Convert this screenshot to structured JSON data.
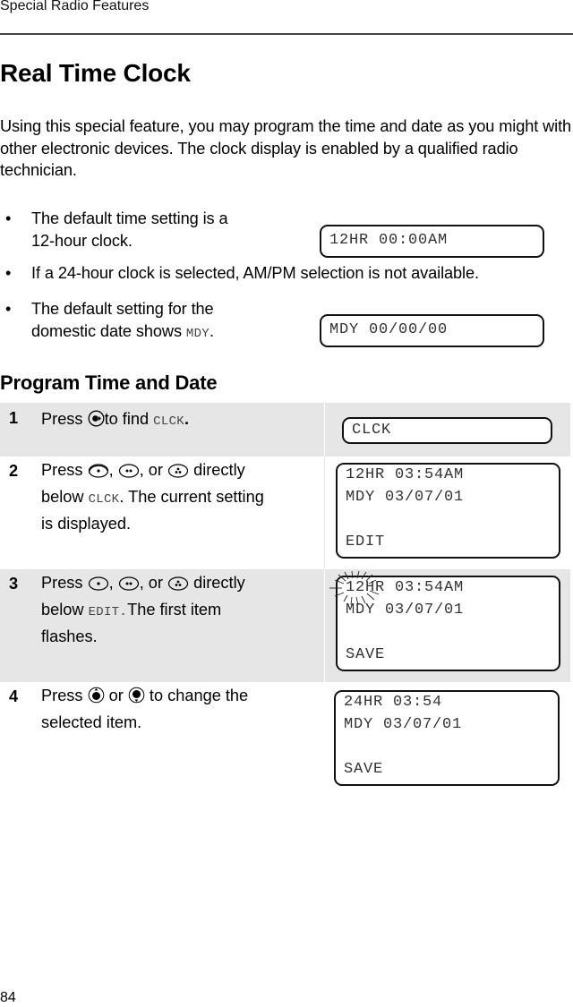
{
  "header": {
    "running_head": "Special Radio Features"
  },
  "page_title": "Real Time Clock",
  "intro": "Using this special feature, you may program the time and date as you might with other electronic devices. The clock display is enabled by a qualified radio technician.",
  "bullets": [
    {
      "text_line1": "The default time setting is a",
      "text_line2": "12-hour clock.",
      "display": "12HR 00:00AM"
    },
    {
      "text_line1": "If a 24-hour clock is selected, AM/PM selection is not available."
    },
    {
      "text_line1": "The default setting for the",
      "text_line2_prefix": "domestic date shows ",
      "text_line2_lcd": "MDY",
      "text_line2_suffix": ".",
      "display": "MDY 00/00/00"
    }
  ],
  "section_title": "Program Time and Date",
  "steps": [
    {
      "number": "1",
      "text": {
        "press": "Press",
        "after_icon": "to find",
        "lcd_word": "CLCK",
        "end": "."
      },
      "icons": [
        "menu-navigation-button"
      ],
      "display": [
        "CLCK"
      ]
    },
    {
      "number": "2",
      "text": {
        "press": "Press",
        "sep1": ",",
        "sep2": ", or",
        "after": "directly",
        "line2_prefix": "below ",
        "lcd_word": "CLCK",
        "line2_suffix": ". The current setting",
        "line3": "is displayed."
      },
      "icons": [
        "soft-key-1-button",
        "soft-key-2-button",
        "soft-key-3-button"
      ],
      "display": [
        "12HR 03:54AM",
        "MDY 03/07/01",
        "",
        "EDIT"
      ]
    },
    {
      "number": "3",
      "text": {
        "press": "Press",
        "sep1": ",",
        "sep2": ", or",
        "after": "directly",
        "line2_prefix": "below ",
        "lcd_word": "EDIT.",
        "line2_suffix": "The first item",
        "line3": "flashes."
      },
      "icons": [
        "soft-key-1-button",
        "soft-key-2-button",
        "soft-key-3-button"
      ],
      "display": [
        "12HR 03:54AM",
        "MDY 03/07/01",
        "",
        "SAVE"
      ],
      "flashing_item": "12HR"
    },
    {
      "number": "4",
      "text": {
        "press": "Press",
        "or": "or",
        "after": "to change the",
        "line2": "selected item."
      },
      "icons": [
        "scroll-up-button",
        "scroll-down-button"
      ],
      "display": [
        "24HR 03:54",
        "MDY 03/07/01",
        "",
        "SAVE"
      ]
    }
  ],
  "footer": {
    "page_number": "84"
  }
}
